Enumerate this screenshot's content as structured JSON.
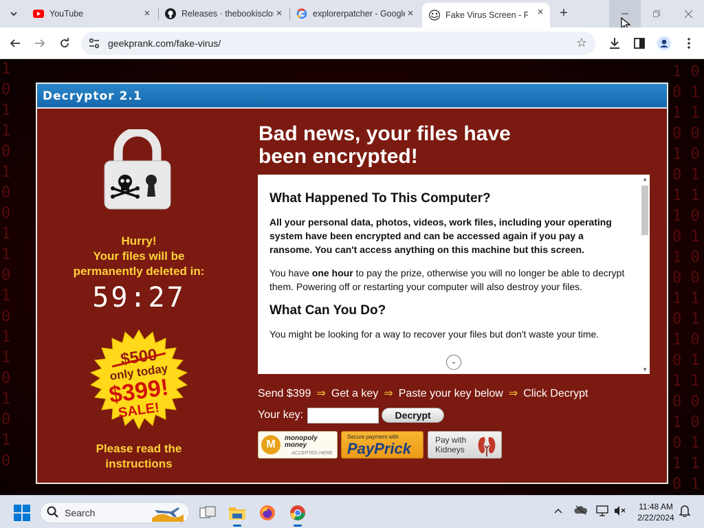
{
  "browser": {
    "tabs": [
      {
        "title": "YouTube",
        "icon": "youtube-icon"
      },
      {
        "title": "Releases · thebookisclosed/ExplorerPatcher",
        "icon": "github-icon"
      },
      {
        "title": "explorerpatcher - Google Search",
        "icon": "google-icon"
      },
      {
        "title": "Fake Virus Screen - File Encryption Prank",
        "icon": "trollface-icon",
        "active": true
      }
    ],
    "url": "geekprank.com/fake-virus/"
  },
  "page": {
    "header_title": "Decryptor 2.1",
    "hurry_line1": "Hurry!",
    "hurry_line2": "Your files will be",
    "hurry_line3": "permanently deleted in:",
    "timer": "59:27",
    "badge": {
      "old_price": "$500",
      "only_today": "only today",
      "new_price": "$399!",
      "sale": "SALE!"
    },
    "please_line1": "Please read the",
    "please_line2": "instructions",
    "headline_line1": "Bad news, your files have",
    "headline_line2": "been encrypted!",
    "info": {
      "h1": "What Happened To This Computer?",
      "p1": "All your personal data, photos, videos, work files, including your operating system have been encrypted and can be accessed again if you pay a ransome. You can't access anything on this machine but this screen.",
      "p2_pre": "You have ",
      "p2_bold": "one hour",
      "p2_post": " to pay the prize, otherwise you will no longer be able to decrypt them. Powering off or restarting your computer will also destroy your files.",
      "h2": "What Can You Do?",
      "p3": "You might be looking for a way to recover your files but don't waste your time."
    },
    "steps": [
      "Send $399",
      "Get a key",
      "Paste your key below",
      "Click Decrypt"
    ],
    "arrow": "⇒",
    "key_label": "Your key:",
    "key_value": "",
    "decrypt_label": "Decrypt",
    "pay": {
      "monopoly_line1": "monopoly",
      "monopoly_line2": "money",
      "monopoly_sub": "ACCEPTED HERE",
      "prick_small": "Secure payment with",
      "prick_big": "PayPrick",
      "kidney_line1": "Pay with",
      "kidney_line2": "Kidneys"
    }
  },
  "taskbar": {
    "search_placeholder": "Search",
    "time": "11:48 AM",
    "date": "2/22/2024"
  },
  "colors": {
    "panel_bg": "#7b1a10",
    "header_blue": "#1668ad",
    "accent_yellow": "#ffd23a"
  }
}
